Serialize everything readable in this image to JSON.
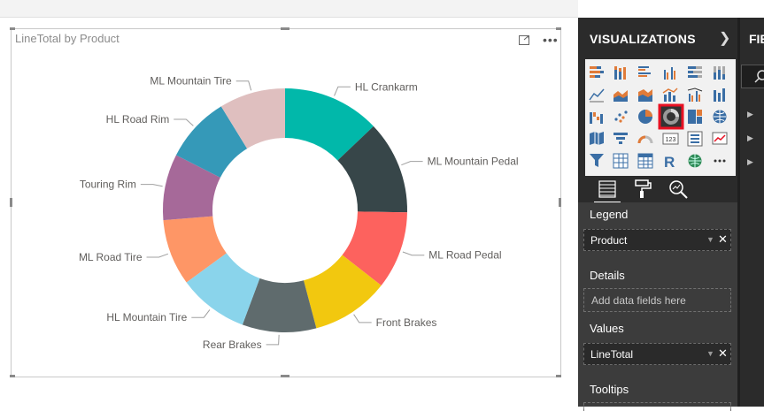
{
  "visual": {
    "title": "LineTotal by Product",
    "more_label": "•••"
  },
  "chart_data": {
    "type": "pie",
    "donut": true,
    "title": "LineTotal by Product",
    "slices": [
      {
        "label": "HL Crankarm",
        "value": 12.5,
        "color": "#01B8AA"
      },
      {
        "label": "ML Mountain Pedal",
        "value": 12.0,
        "color": "#374649"
      },
      {
        "label": "ML Road Pedal",
        "value": 10.0,
        "color": "#FD625E"
      },
      {
        "label": "Front Brakes",
        "value": 10.0,
        "color": "#F2C80F"
      },
      {
        "label": "Rear Brakes",
        "value": 9.5,
        "color": "#5F6B6D"
      },
      {
        "label": "HL Mountain Tire",
        "value": 9.0,
        "color": "#8AD4EB"
      },
      {
        "label": "ML Road Tire",
        "value": 8.5,
        "color": "#FE9666"
      },
      {
        "label": "Touring Rim",
        "value": 8.5,
        "color": "#A66999"
      },
      {
        "label": "HL Road Rim",
        "value": 8.5,
        "color": "#3599B8"
      },
      {
        "label": "ML Mountain Tire",
        "value": 8.5,
        "color": "#DFBFBF"
      }
    ]
  },
  "visualizations": {
    "title": "VISUALIZATIONS",
    "expand_icon": "chevron-right-icon",
    "selected": "donut-chart",
    "icons": [
      "stacked-bar-chart",
      "stacked-column-chart",
      "clustered-bar-chart",
      "clustered-column-chart",
      "100-stacked-bar-chart",
      "100-stacked-column-chart",
      "line-chart",
      "area-chart",
      "stacked-area-chart",
      "line-and-column-chart",
      "line-and-clustered-column-chart",
      "ribbon-chart",
      "waterfall-chart",
      "scatter-chart",
      "pie-chart",
      "donut-chart",
      "treemap",
      "map",
      "filled-map",
      "funnel",
      "gauge",
      "card",
      "multi-row-card",
      "kpi",
      "slicer",
      "table",
      "matrix",
      "r-script-visual",
      "globe",
      "more-visuals"
    ],
    "tabs": [
      "fields-tab",
      "format-tab",
      "analytics-tab"
    ],
    "wells": {
      "legend_label": "Legend",
      "legend_field": "Product",
      "details_label": "Details",
      "details_placeholder": "Add data fields here",
      "values_label": "Values",
      "values_field": "LineTotal",
      "tooltips_label": "Tooltips",
      "remove_glyph": "✕",
      "dropdown_glyph": "▼"
    }
  },
  "fields": {
    "title": "FIELDS"
  }
}
